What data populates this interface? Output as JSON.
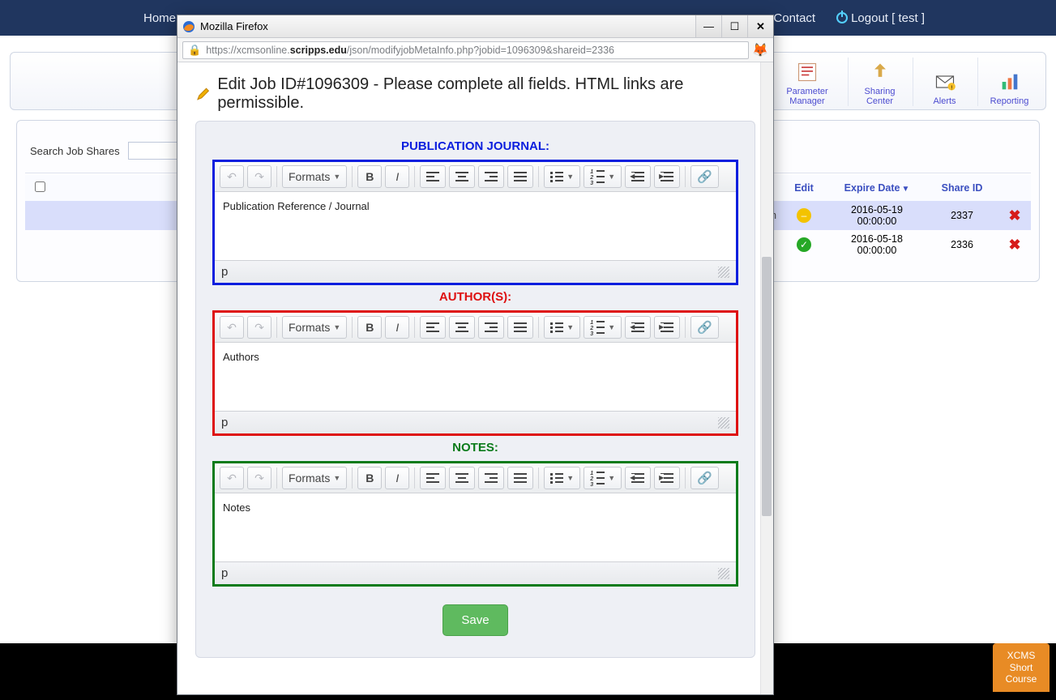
{
  "nav": {
    "home": "Home",
    "contact": "Contact",
    "logout": "Logout [ test ]"
  },
  "ribbon": {
    "param_mgr": "Parameter Manager",
    "sharing": "Sharing Center",
    "alerts": "Alerts",
    "reporting": "Reporting"
  },
  "search": {
    "label": "Search Job Shares"
  },
  "table": {
    "headers": {
      "edit": "Edit",
      "expire": "Expire Date",
      "shareid": "Share ID"
    },
    "rows": [
      {
        "edit_status": "pending",
        "expire": "2016-05-19 00:00:00",
        "shareid": "2337"
      },
      {
        "edit_status": "ok",
        "expire": "2016-05-18 00:00:00",
        "shareid": "2336"
      }
    ]
  },
  "course_tab": "XCMS\nShort\nCourse",
  "ff": {
    "title": "Mozilla Firefox",
    "url_prefix": "https://xcmsonline.",
    "url_bold": "scripps.edu",
    "url_rest": "/json/modifyjobMetaInfo.php?jobid=1096309&shareid=2336"
  },
  "page": {
    "title": "Edit Job ID#1096309 - Please complete all fields. HTML links are permissible."
  },
  "editors": {
    "formats": "Formats",
    "status": "p",
    "pub": {
      "label": "PUBLICATION JOURNAL:",
      "placeholder": "Publication Reference / Journal"
    },
    "auth": {
      "label": "AUTHOR(S):",
      "placeholder": "Authors"
    },
    "notes": {
      "label": "NOTES:",
      "placeholder": "Notes"
    }
  },
  "save": "Save"
}
